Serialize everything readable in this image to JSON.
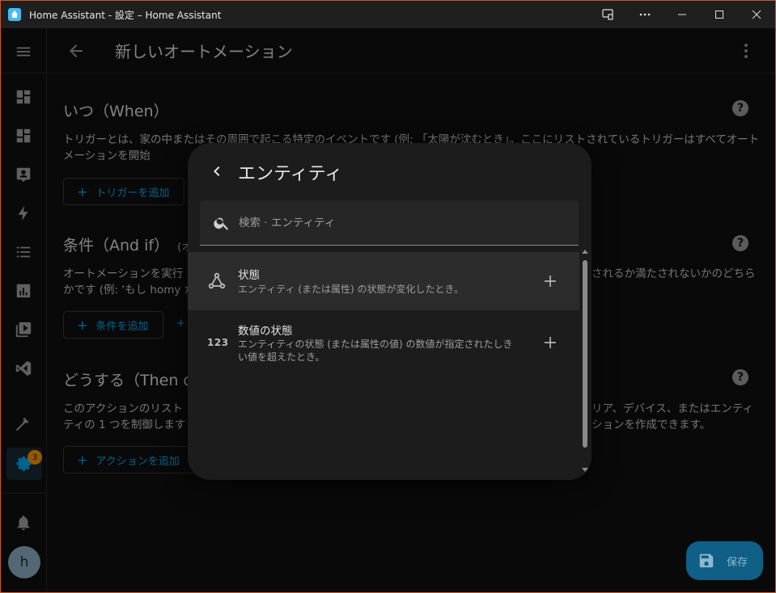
{
  "window": {
    "title": "Home Assistant - 設定 – Home Assistant"
  },
  "header": {
    "title": "新しいオートメーション"
  },
  "sidebar": {
    "settings_badge": "3",
    "avatar_letter": "h"
  },
  "sections": {
    "when": {
      "title": "いつ（When）",
      "desc": "トリガーとは、家の中またはその周囲で起こる特定のイベントです (例: 「太陽が沈むとき」。ここにリストされているトリガーはすべてオートメーションを開始",
      "add_label": "トリガーを追加"
    },
    "andif": {
      "title": "条件（And if）",
      "title_tail": "(オ",
      "desc_left": "オートメーションを実行",
      "desc_left2": "かです (例: 'もし homy か",
      "desc_right": "されるか満たされないかのどちら",
      "add_label": "条件を追加"
    },
    "then": {
      "title": "どうする（Then d",
      "desc_left": "このアクションのリスト",
      "desc_left2": "ティの 1 つを制御します",
      "desc_right": "リア、デバイス、またはエンティ",
      "desc_right2": "ションを作成できます。",
      "add_label": "アクションを追加"
    }
  },
  "dialog": {
    "title": "エンティティ",
    "search_placeholder": "検索 · エンティティ",
    "items": [
      {
        "title": "状態",
        "subtitle": "エンティティ (または属性) の状態が変化したとき。",
        "icon": "state-graph-icon"
      },
      {
        "title": "数値の状態",
        "subtitle": "エンティティの状態 (または属性の値) の数値が指定されたしきい値を超えたとき。",
        "icon_text": "123"
      }
    ]
  },
  "fab": {
    "label": "保存"
  },
  "colors": {
    "accent": "#03a9f4",
    "badge": "#ff9800",
    "fab_bg": "#0f5f86"
  }
}
